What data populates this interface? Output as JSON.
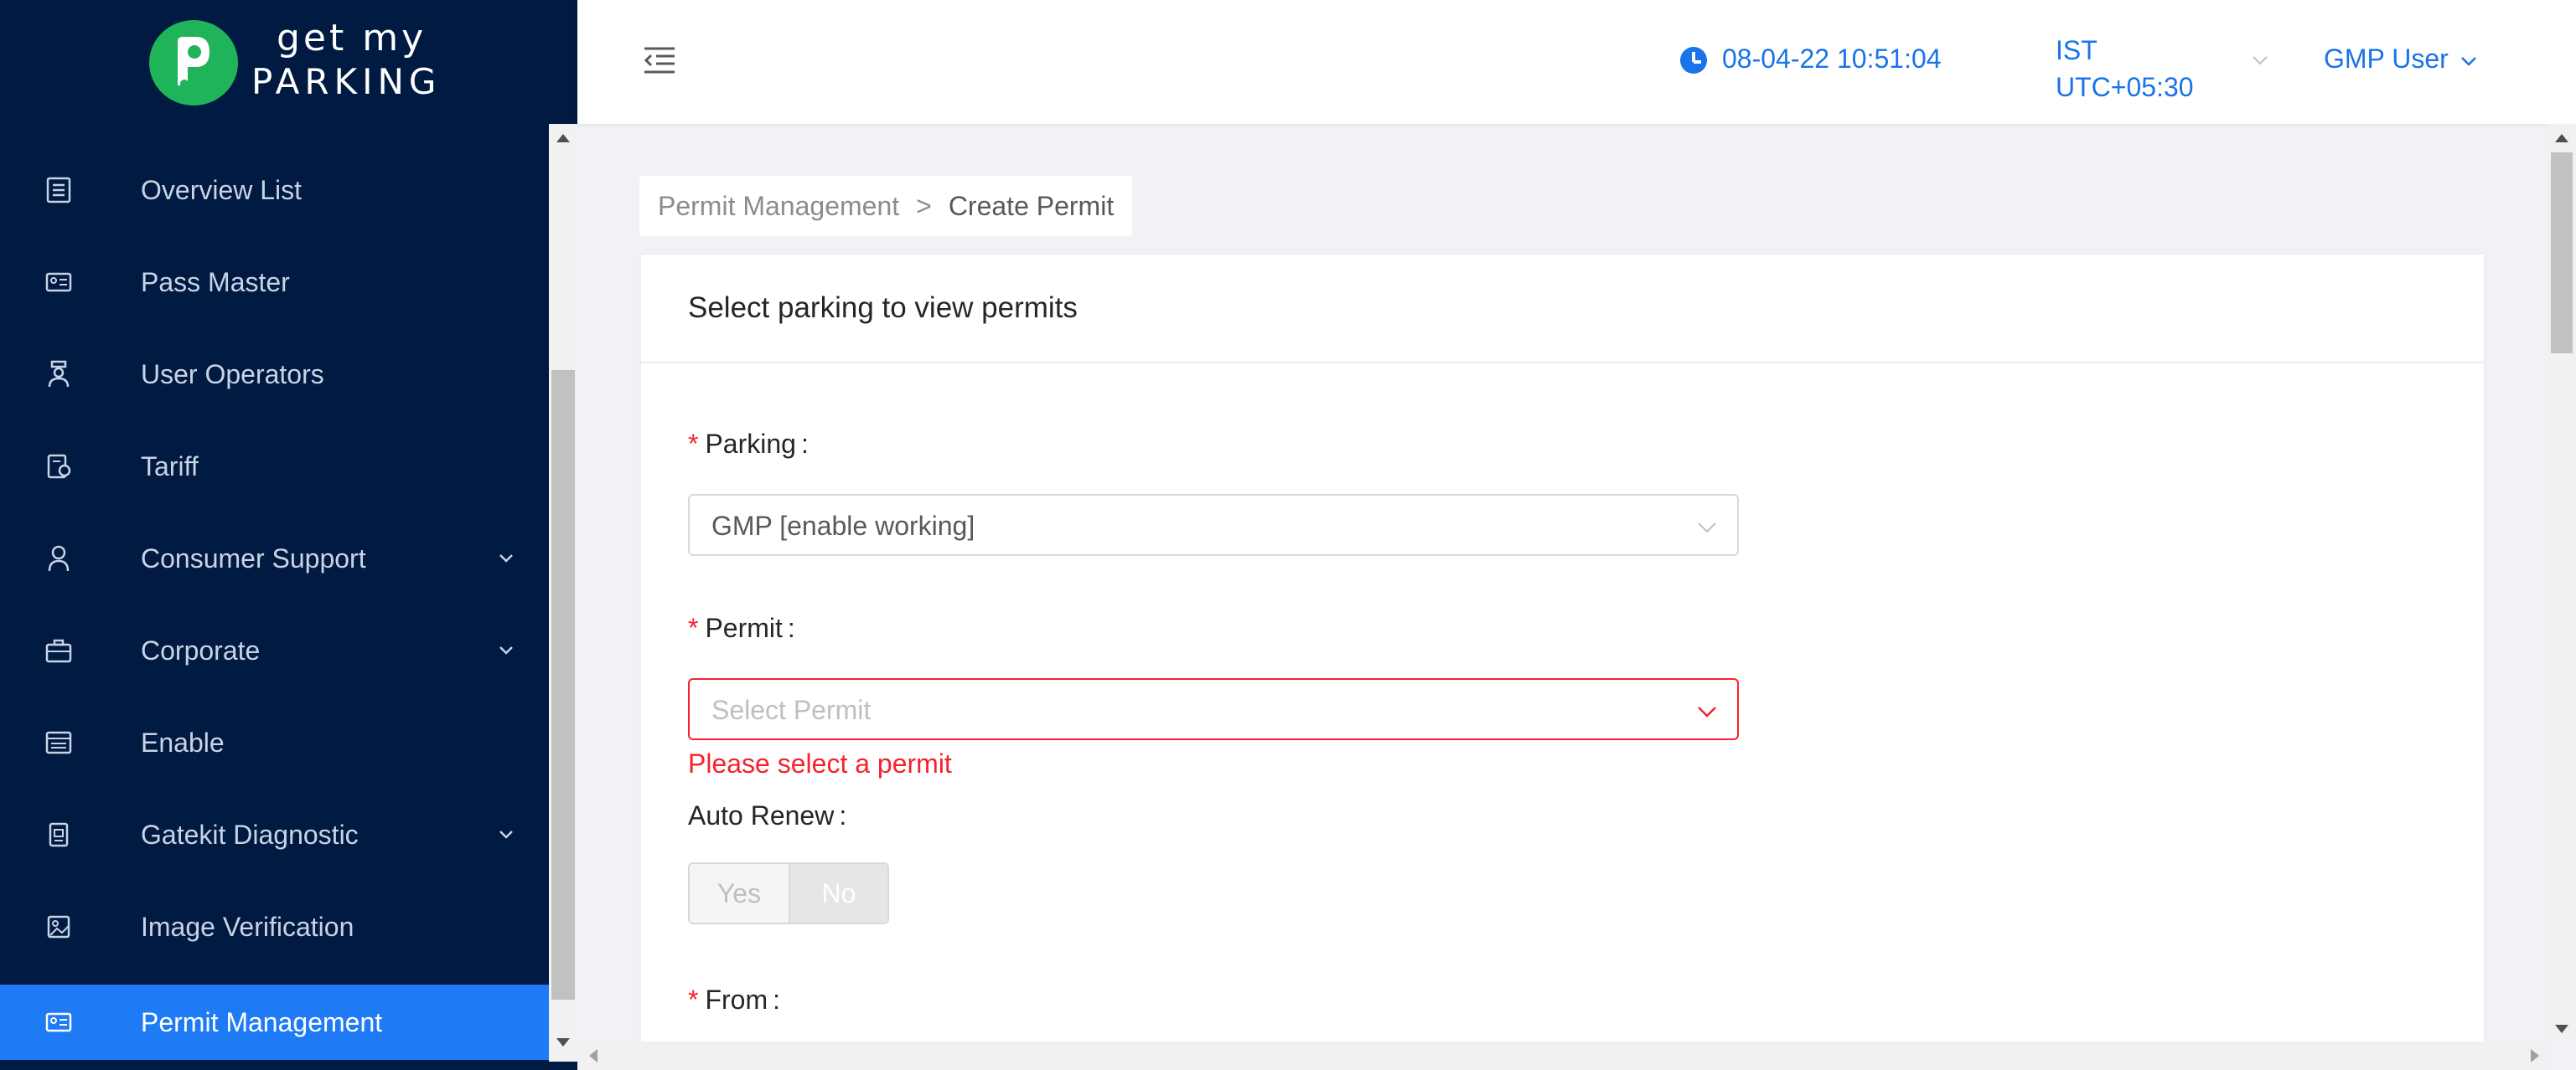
{
  "brand": {
    "logo_line1": "get my",
    "logo_line2": "PARKING",
    "color": "#1fb45a"
  },
  "sidebar": {
    "background": "#001a41",
    "active_color": "#1e7af5",
    "items": [
      {
        "label": "Overview List",
        "icon": "list-icon",
        "has_submenu": false,
        "active": false
      },
      {
        "label": "Pass Master",
        "icon": "id-card-icon",
        "has_submenu": false,
        "active": false
      },
      {
        "label": "User Operators",
        "icon": "user-operator-icon",
        "has_submenu": false,
        "active": false
      },
      {
        "label": "Tariff",
        "icon": "tariff-icon",
        "has_submenu": false,
        "active": false
      },
      {
        "label": "Consumer Support",
        "icon": "user-icon",
        "has_submenu": true,
        "active": false
      },
      {
        "label": "Corporate",
        "icon": "briefcase-icon",
        "has_submenu": true,
        "active": false
      },
      {
        "label": "Enable",
        "icon": "enable-icon",
        "has_submenu": false,
        "active": false
      },
      {
        "label": "Gatekit Diagnostic",
        "icon": "diagnostic-icon",
        "has_submenu": true,
        "active": false
      },
      {
        "label": "Image Verification",
        "icon": "image-icon",
        "has_submenu": false,
        "active": false
      },
      {
        "label": "Permit Management",
        "icon": "permit-card-icon",
        "has_submenu": false,
        "active": true
      }
    ]
  },
  "header": {
    "datetime": "08-04-22 10:51:04",
    "timezone_line1": "IST",
    "timezone_line2": "UTC+05:30",
    "user": "GMP User",
    "accent": "#1a73e8"
  },
  "breadcrumb": {
    "parent": "Permit Management",
    "separator": ">",
    "current": "Create Permit"
  },
  "card": {
    "title": "Select parking to view permits"
  },
  "form": {
    "parking": {
      "label": "Parking",
      "value": "GMP [enable working]",
      "required": true
    },
    "permit": {
      "label": "Permit",
      "placeholder": "Select Permit",
      "required": true,
      "error": "Please select a permit",
      "error_color": "#f5222d"
    },
    "auto_renew": {
      "label": "Auto Renew",
      "options": [
        "Yes",
        "No"
      ],
      "selected": "No"
    },
    "from": {
      "label": "From",
      "required": true
    }
  }
}
